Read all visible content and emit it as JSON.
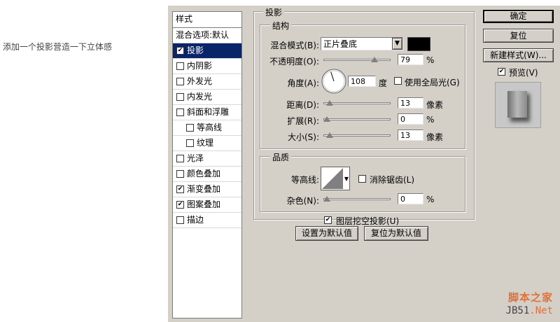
{
  "caption": "添加一个投影营造一下立体感",
  "styles_panel": {
    "header": "样式",
    "blending": "混合选项:默认",
    "items": [
      {
        "label": "投影",
        "checked": true,
        "selected": true,
        "sub": false
      },
      {
        "label": "内阴影",
        "checked": false,
        "selected": false,
        "sub": false
      },
      {
        "label": "外发光",
        "checked": false,
        "selected": false,
        "sub": false
      },
      {
        "label": "内发光",
        "checked": false,
        "selected": false,
        "sub": false
      },
      {
        "label": "斜面和浮雕",
        "checked": false,
        "selected": false,
        "sub": false
      },
      {
        "label": "等高线",
        "checked": false,
        "selected": false,
        "sub": true
      },
      {
        "label": "纹理",
        "checked": false,
        "selected": false,
        "sub": true
      },
      {
        "label": "光泽",
        "checked": false,
        "selected": false,
        "sub": false
      },
      {
        "label": "颜色叠加",
        "checked": false,
        "selected": false,
        "sub": false
      },
      {
        "label": "渐变叠加",
        "checked": true,
        "selected": false,
        "sub": false
      },
      {
        "label": "图案叠加",
        "checked": true,
        "selected": false,
        "sub": false
      },
      {
        "label": "描边",
        "checked": false,
        "selected": false,
        "sub": false
      }
    ]
  },
  "drop_shadow": {
    "title": "投影",
    "structure": {
      "title": "结构",
      "blend_mode_label": "混合模式(B):",
      "blend_mode_value": "正片叠底",
      "shadow_color": "#000000",
      "opacity_label": "不透明度(O):",
      "opacity_value": "79",
      "opacity_unit": "%",
      "opacity_fraction": 0.79,
      "angle_label": "角度(A):",
      "angle_value": "108",
      "angle_unit": "度",
      "global_light_label": "使用全局光(G)",
      "global_light_checked": false,
      "distance_label": "距离(D):",
      "distance_value": "13",
      "distance_unit": "像素",
      "distance_fraction": 0.05,
      "spread_label": "扩展(R):",
      "spread_value": "0",
      "spread_unit": "%",
      "spread_fraction": 0.0,
      "size_label": "大小(S):",
      "size_value": "13",
      "size_unit": "像素",
      "size_fraction": 0.05
    },
    "quality": {
      "title": "品质",
      "contour_label": "等高线:",
      "antialias_label": "消除锯齿(L)",
      "antialias_checked": false,
      "noise_label": "杂色(N):",
      "noise_value": "0",
      "noise_unit": "%",
      "noise_fraction": 0.0
    },
    "knockout_label": "图层挖空投影(U)",
    "knockout_checked": true,
    "set_default_label": "设置为默认值",
    "reset_default_label": "复位为默认值"
  },
  "buttons": {
    "ok": "确定",
    "reset": "复位",
    "new_style": "新建样式(W)...",
    "preview_label": "预览(V)",
    "preview_checked": true
  },
  "watermark": {
    "line1": "脚本之家",
    "line2_a": "JB51",
    "line2_b": ".Net"
  },
  "check_glyph": "✔"
}
